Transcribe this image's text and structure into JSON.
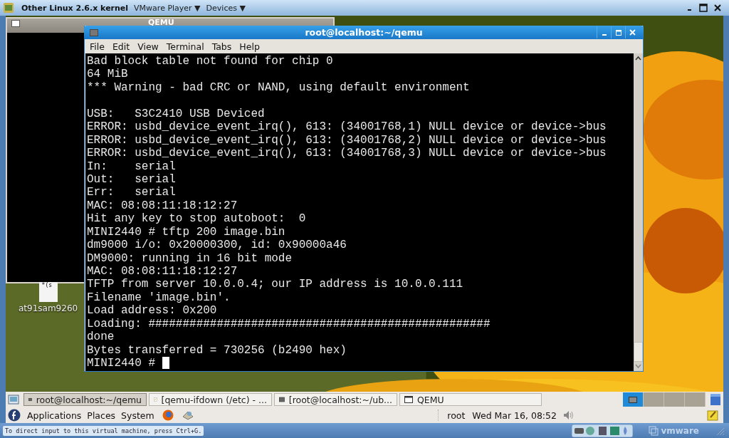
{
  "vmware": {
    "title": "Other Linux 2.6.x kernel",
    "menus": [
      "VMware Player ▼",
      "Devices ▼"
    ]
  },
  "qemu_window": {
    "title": "QEMU"
  },
  "desktop_icon": {
    "preview": "*(s",
    "label": "at91sam9260"
  },
  "terminal": {
    "title": "root@localhost:~/qemu",
    "menu": [
      "File",
      "Edit",
      "View",
      "Terminal",
      "Tabs",
      "Help"
    ],
    "lines": [
      {
        "text": "Bad block table not found for chip 0"
      },
      {
        "text": "64 MiB"
      },
      {
        "text": "*** Warning - bad CRC or NAND, using default environment"
      },
      {
        "text": "USB:   S3C2410 USB Deviced",
        "blank_before": true
      },
      {
        "text": "ERROR: usbd_device_event_irq(), 613: (34001768,1) NULL device or device->bus"
      },
      {
        "text": "ERROR: usbd_device_event_irq(), 613: (34001768,2) NULL device or device->bus"
      },
      {
        "text": "ERROR: usbd_device_event_irq(), 613: (34001768,3) NULL device or device->bus"
      },
      {
        "text": "In:    serial"
      },
      {
        "text": "Out:   serial"
      },
      {
        "text": "Err:   serial"
      },
      {
        "text": "MAC: 08:08:11:18:12:27"
      },
      {
        "text": "Hit any key to stop autoboot:  0"
      },
      {
        "text": "MINI2440 # tftp 200 image.bin"
      },
      {
        "text": "dm9000 i/o: 0x20000300, id: 0x90000a46"
      },
      {
        "text": "DM9000: running in 16 bit mode"
      },
      {
        "text": "MAC: 08:08:11:18:12:27"
      },
      {
        "text": "TFTP from server 10.0.0.4; our IP address is 10.0.0.111"
      },
      {
        "text": "Filename 'image.bin'."
      },
      {
        "text": "Load address: 0x200"
      },
      {
        "text": "Loading: ##################################################"
      },
      {
        "text": "done"
      },
      {
        "text": "Bytes transferred = 730256 (b2490 hex)"
      },
      {
        "text": "MINI2440 # ",
        "cursor": true
      }
    ]
  },
  "taskbar": {
    "tasks": [
      {
        "label": "root@localhost:~/qemu",
        "kind": "terminal",
        "selected": true
      },
      {
        "label": "[qemu-ifdown (/etc) - ...",
        "kind": "editor",
        "selected": false
      },
      {
        "label": "[root@localhost:~/ub...",
        "kind": "terminal",
        "selected": false
      },
      {
        "label": "QEMU",
        "kind": "window",
        "selected": false
      }
    ],
    "workspaces": [
      {
        "selected": true
      },
      {
        "selected": false
      },
      {
        "selected": false
      },
      {
        "selected": false
      }
    ]
  },
  "panel": {
    "menus": [
      "Applications",
      "Places",
      "System"
    ],
    "user": "root",
    "clock": "Wed Mar 16, 08:52"
  },
  "status_bar": {
    "hint": "To direct input to this virtual machine, press Ctrl+G.",
    "logo": "vmware"
  }
}
